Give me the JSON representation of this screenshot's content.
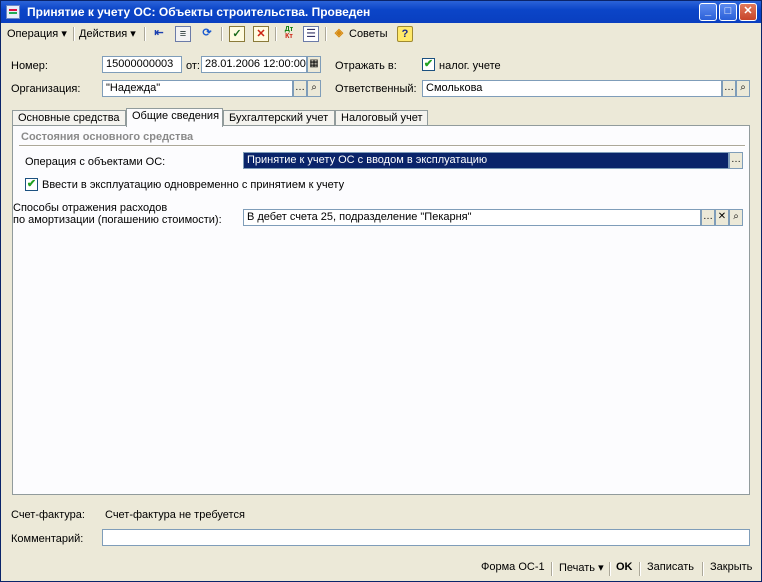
{
  "window": {
    "title": "Принятие к учету ОС: Объекты строительства. Проведен"
  },
  "toolbar": {
    "operation_menu": "Операция",
    "actions_menu": "Действия",
    "tips": "Советы",
    "help": "?",
    "icons": [
      "arrow-left-icon",
      "document-icon",
      "refresh-icon",
      "post-icon",
      "unpost-icon",
      "dt-kt-icon",
      "list-icon",
      "tips-icon"
    ]
  },
  "header": {
    "number_label": "Номер:",
    "number_value": "15000000003",
    "date_label": "от:",
    "date_value": "28.01.2006 12:00:00",
    "reflect_label": "Отражать в:",
    "tax_label": "налог. учете",
    "tax_checked": "✔",
    "org_label": "Организация:",
    "org_value": "\"Надежда\"",
    "responsible_label": "Ответственный:",
    "responsible_value": "Смолькова"
  },
  "tabs": [
    {
      "label": "Основные средства"
    },
    {
      "label": "Общие сведения"
    },
    {
      "label": "Бухгалтерский учет"
    },
    {
      "label": "Налоговый учет"
    }
  ],
  "general": {
    "group_title": "Состояния основного средства",
    "operation_label": "Операция с объектами ОС:",
    "operation_value": "Принятие к учету ОС с вводом в эксплуатацию",
    "commission_label": "Ввести в эксплуатацию одновременно с принятием к учету",
    "commission_checked": "✔",
    "methods_label_1": "Способы отражения расходов",
    "methods_label_2": "по амортизации (погашению стоимости):",
    "methods_value": "В дебет счета 25, подразделение \"Пекарня\""
  },
  "footer": {
    "invoice_label": "Счет-фактура:",
    "invoice_value": "Счет-фактура не требуется",
    "comment_label": "Комментарий:",
    "comment_value": ""
  },
  "statusbar": {
    "form": "Форма ОС-1",
    "print": "Печать",
    "ok": "OK",
    "save": "Записать",
    "close": "Закрыть"
  },
  "colors": {
    "title_bar": "#0b45c8",
    "selection": "#0a246a",
    "window_bg": "#ece9d8"
  }
}
